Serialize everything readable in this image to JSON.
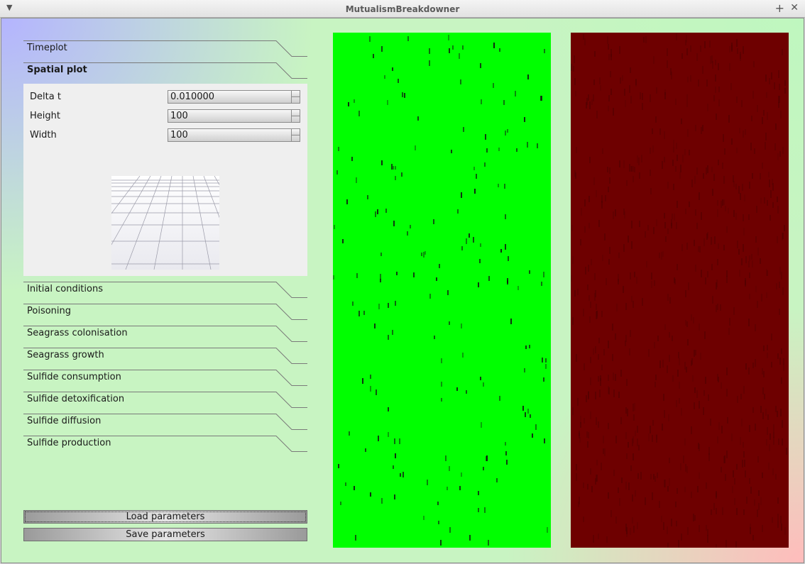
{
  "window": {
    "title": "MutualismBreakdowner",
    "menu_icon": "dropdown-arrow-icon",
    "maximize_icon": "plus-icon",
    "close_icon": "close-icon"
  },
  "toolbox": {
    "sections": [
      {
        "label": "Timeplot",
        "active": false
      },
      {
        "label": "Spatial plot",
        "active": true
      },
      {
        "label": "Initial conditions",
        "active": false
      },
      {
        "label": "Poisoning",
        "active": false
      },
      {
        "label": "Seagrass colonisation",
        "active": false
      },
      {
        "label": "Seagrass growth",
        "active": false
      },
      {
        "label": "Sulfide consumption",
        "active": false
      },
      {
        "label": "Sulfide detoxification",
        "active": false
      },
      {
        "label": "Sulfide diffusion",
        "active": false
      },
      {
        "label": "Sulfide production",
        "active": false
      }
    ],
    "spatial_plot": {
      "fields": [
        {
          "label": "Delta t",
          "value": "0.010000"
        },
        {
          "label": "Height",
          "value": "100"
        },
        {
          "label": "Width",
          "value": "100"
        }
      ],
      "preview_icon": "3d-grid-plane-icon"
    }
  },
  "buttons": {
    "load": "Load parameters",
    "save": "Save parameters"
  },
  "plots": {
    "seagrass": {
      "background": "#00ff00",
      "speck_color": "#111111"
    },
    "sulfide": {
      "background": "#6e0000",
      "speck_color": "#4a0000"
    }
  }
}
